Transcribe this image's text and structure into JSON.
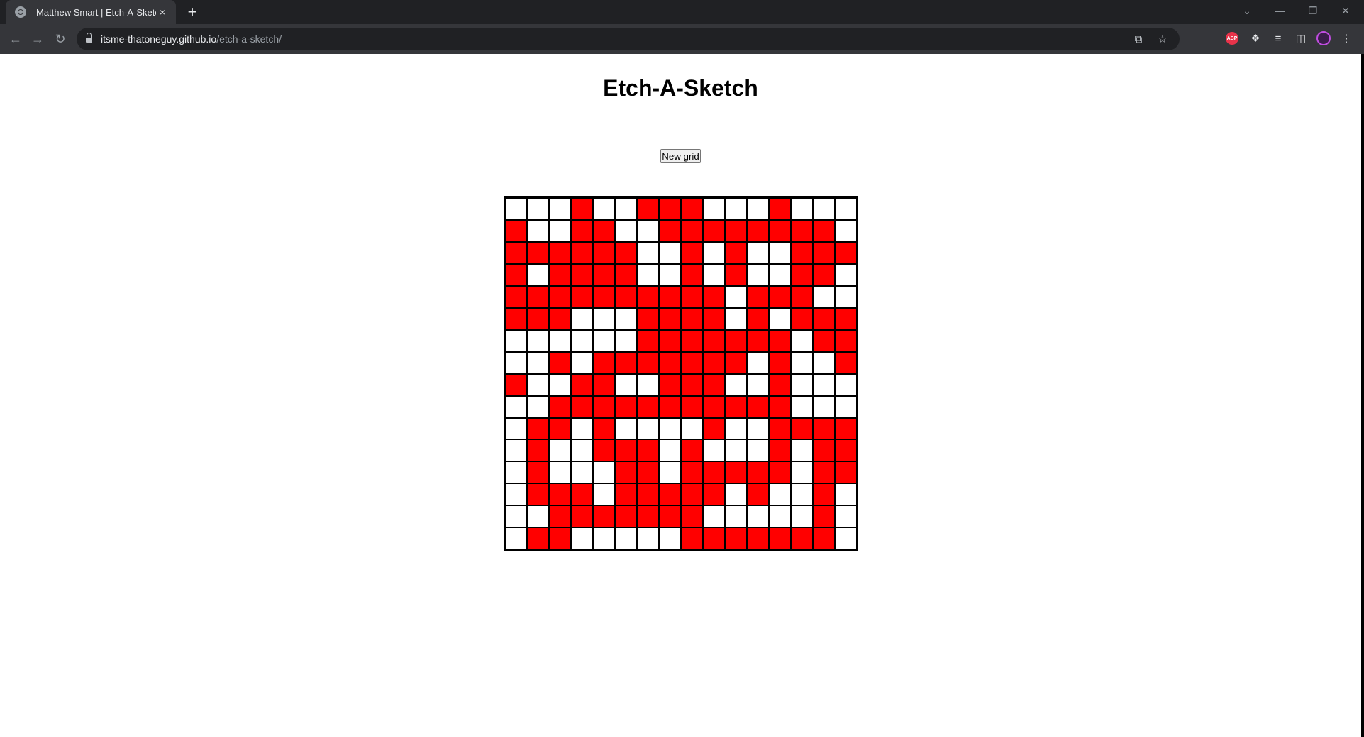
{
  "browser": {
    "tab_title": "Matthew Smart | Etch-A-Sketch",
    "tab_close": "×",
    "new_tab": "+",
    "url_host": "itsme-thatoneguy.github.io",
    "url_path": "/etch-a-sketch/",
    "extension_abp": "ABP"
  },
  "page": {
    "title": "Etch-A-Sketch",
    "button_label": "New grid"
  },
  "grid": {
    "size": 16,
    "colors": {
      "filled": "#ff0000",
      "empty": "#ffffff",
      "border": "#000000"
    },
    "rows": [
      "...X..XXX...X...",
      "X..XX..XXXXXXXX.",
      "XXXXXX..X.X..XXX",
      "X.XXXX..X.X..XX.",
      "XXXXXXXXXX.XXX..",
      "XXX...XXXX.X.XXX",
      "......XXXXXXX.XX",
      "..X.XXXXXXX.X..X",
      "X..XX..XXX..X...",
      "..XXXXXXXXXXX...",
      ".XX.X....X..XXXX",
      ".X..XXX.X...X.XX",
      ".X...XX.XXXXX.XX",
      ".XXX.XXXXX.X..X.",
      "..XXXXXXX.....X.",
      ".XX.....XXXXXXX."
    ]
  }
}
